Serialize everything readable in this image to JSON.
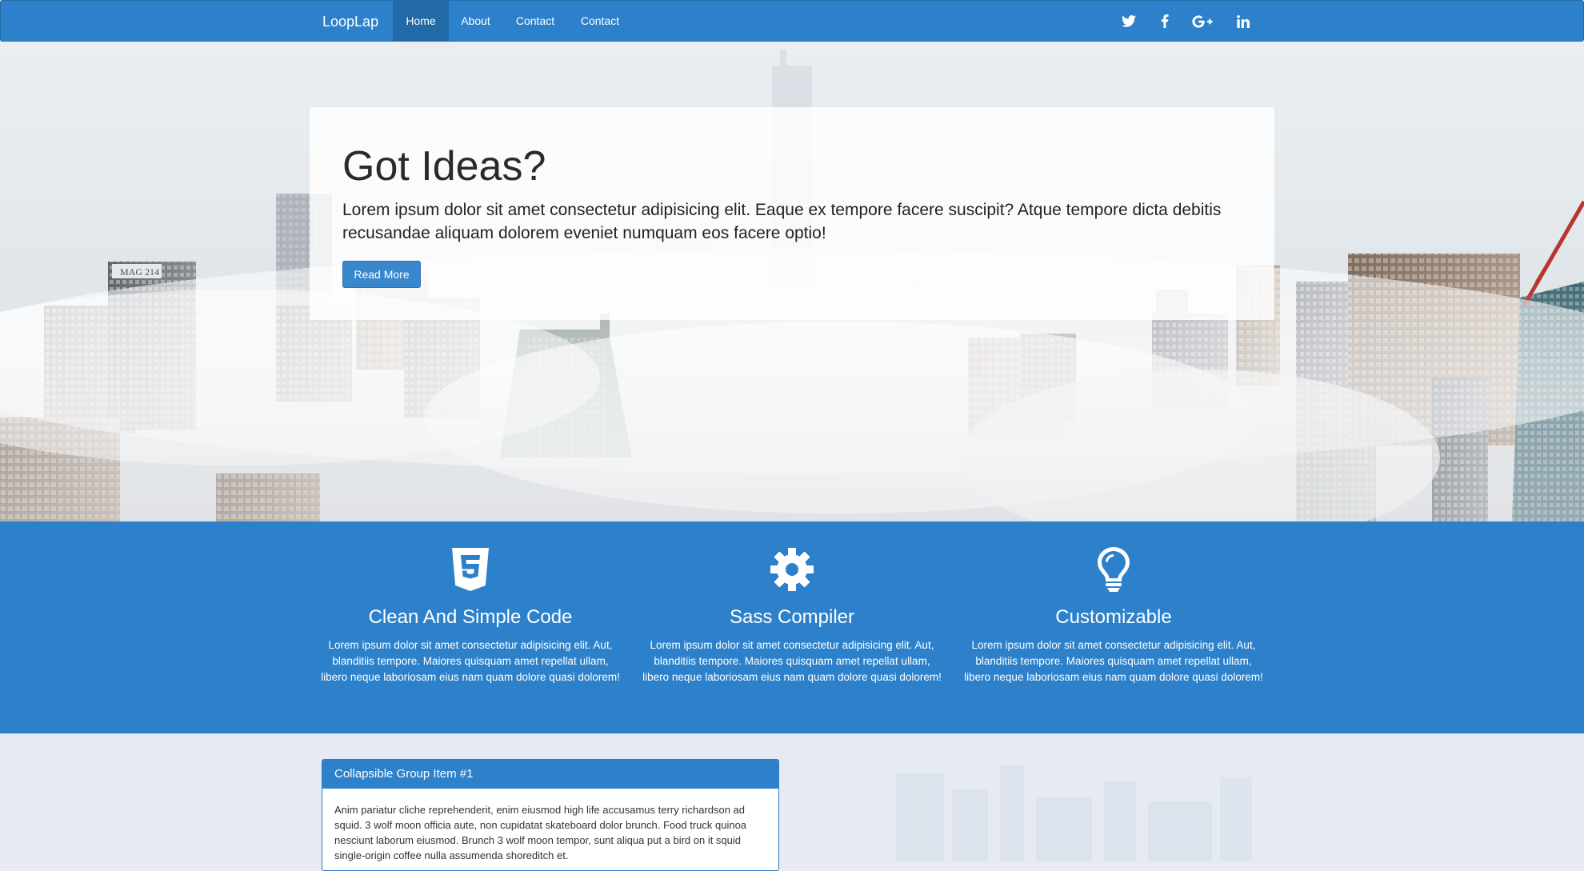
{
  "navbar": {
    "brand": "LoopLap",
    "items": [
      {
        "label": "Home",
        "active": true
      },
      {
        "label": "About",
        "active": false
      },
      {
        "label": "Contact",
        "active": false
      },
      {
        "label": "Contact",
        "active": false
      }
    ],
    "social": [
      "twitter-icon",
      "facebook-icon",
      "google-plus-icon",
      "linkedin-icon"
    ]
  },
  "hero": {
    "title": "Got Ideas?",
    "text": "Lorem ipsum dolor sit amet consectetur adipisicing elit. Eaque ex tempore facere suscipit? Atque tempore dicta debitis recusandae aliquam dolorem eveniet numquam eos facere optio!",
    "button": "Read More",
    "building_sign": "MAG 214"
  },
  "features": [
    {
      "icon": "html5-icon",
      "title": "Clean And Simple Code",
      "text": "Lorem ipsum dolor sit amet consectetur adipisicing elit. Aut, blanditiis tempore. Maiores quisquam amet repellat ullam, libero neque laboriosam eius nam quam dolore quasi dolorem!"
    },
    {
      "icon": "gear-icon",
      "title": "Sass Compiler",
      "text": "Lorem ipsum dolor sit amet consectetur adipisicing elit. Aut, blanditiis tempore. Maiores quisquam amet repellat ullam, libero neque laboriosam eius nam quam dolore quasi dolorem!"
    },
    {
      "icon": "lightbulb-icon",
      "title": "Customizable",
      "text": "Lorem ipsum dolor sit amet consectetur adipisicing elit. Aut, blanditiis tempore. Maiores quisquam amet repellat ullam, libero neque laboriosam eius nam quam dolore quasi dolorem!"
    }
  ],
  "accordion": {
    "heading": "Collapsible Group Item #1",
    "body": "Anim pariatur cliche reprehenderit, enim eiusmod high life accusamus terry richardson ad squid. 3 wolf moon officia aute, non cupidatat skateboard dolor brunch. Food truck quinoa nesciunt laborum eiusmod. Brunch 3 wolf moon tempor, sunt aliqua put a bird on it squid single-origin coffee nulla assumenda shoreditch et."
  },
  "colors": {
    "primary": "#2d81ca",
    "nav_active": "#2269a8",
    "button": "#3987cd",
    "page_bg": "#e6ebf3"
  }
}
